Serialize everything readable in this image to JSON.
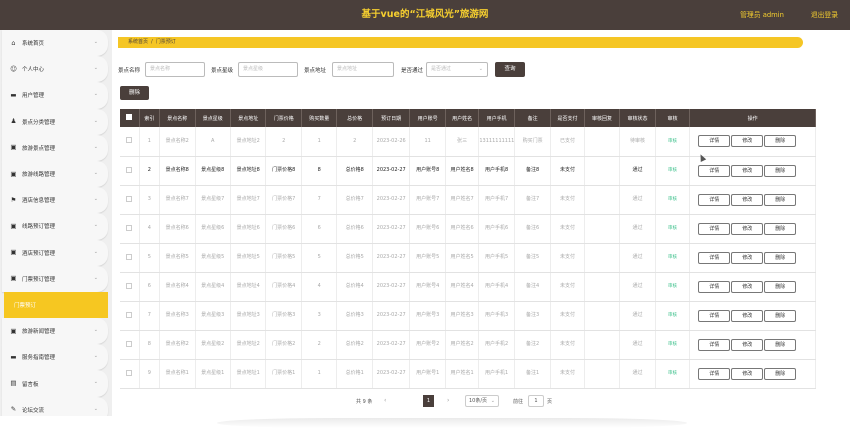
{
  "header": {
    "title": "基于vue的“江城风光”旅游网",
    "user": "管理员 admin",
    "logout": "退出登录"
  },
  "sidebar": {
    "items": [
      {
        "icon": "⌂",
        "label": "系统首页",
        "sub": false,
        "active": false
      },
      {
        "icon": "☺",
        "label": "个人中心",
        "sub": false,
        "active": false
      },
      {
        "icon": "▬",
        "label": "用户管理",
        "sub": false,
        "active": false
      },
      {
        "icon": "♟",
        "label": "景点分类管理",
        "sub": false,
        "active": false
      },
      {
        "icon": "▣",
        "label": "旅游景点管理",
        "sub": false,
        "active": false
      },
      {
        "icon": "▣",
        "label": "旅游线路管理",
        "sub": false,
        "active": false
      },
      {
        "icon": "⚑",
        "label": "酒店信息管理",
        "sub": false,
        "active": false
      },
      {
        "icon": "▣",
        "label": "线路预订管理",
        "sub": false,
        "active": false
      },
      {
        "icon": "▣",
        "label": "酒店预订管理",
        "sub": false,
        "active": false
      },
      {
        "icon": "▣",
        "label": "门票预订管理",
        "sub": false,
        "active": false
      },
      {
        "icon": "",
        "label": "门票预订",
        "sub": true,
        "active": true
      },
      {
        "icon": "▣",
        "label": "旅游新闻管理",
        "sub": false,
        "active": false
      },
      {
        "icon": "▬",
        "label": "服务指南管理",
        "sub": false,
        "active": false
      },
      {
        "icon": "▤",
        "label": "留言板",
        "sub": false,
        "active": false
      },
      {
        "icon": "✎",
        "label": "论坛交流",
        "sub": false,
        "active": false
      }
    ]
  },
  "breadcrumb": {
    "home": "系统首页",
    "sep": "/",
    "current": "门票预订"
  },
  "search": {
    "name_label": "景点名称",
    "name_placeholder": "景点名称",
    "star_label": "景点星级",
    "star_placeholder": "景点星级",
    "addr_label": "景点地址",
    "addr_placeholder": "景点地址",
    "paid_label": "是否通过",
    "paid_placeholder": "是否通过",
    "query_label": "查询"
  },
  "delete_all_label": "删除",
  "table": {
    "headers": [
      "",
      "索引",
      "景点名称",
      "景点星级",
      "景点地址",
      "门票价格",
      "购买数量",
      "总价格",
      "预订日期",
      "用户账号",
      "用户姓名",
      "用户手机",
      "备注",
      "是否支付",
      "审核回复",
      "审核状态",
      "审核",
      "操作"
    ],
    "rows": [
      {
        "idx": "1",
        "name": "景点名称2",
        "star": "A",
        "addr": "景点地址2",
        "price": "2",
        "qty": "1",
        "total": "2",
        "date": "2023-02-26",
        "acct": "11",
        "uname": "张三",
        "phone": "13111111111",
        "note": "购买门票",
        "pay": "已支付",
        "reply": "",
        "status": "待审核",
        "audit": "审核",
        "hl": false
      },
      {
        "idx": "2",
        "name": "景点名称8",
        "star": "景点星级8",
        "addr": "景点地址8",
        "price": "门票价格8",
        "qty": "8",
        "total": "总价格8",
        "date": "2023-02-27",
        "acct": "用户账号8",
        "uname": "用户姓名8",
        "phone": "用户手机8",
        "note": "备注8",
        "pay": "未支付",
        "reply": "",
        "status": "通过",
        "audit": "审核",
        "hl": true
      },
      {
        "idx": "3",
        "name": "景点名称7",
        "star": "景点星级7",
        "addr": "景点地址7",
        "price": "门票价格7",
        "qty": "7",
        "total": "总价格7",
        "date": "2023-02-27",
        "acct": "用户账号7",
        "uname": "用户姓名7",
        "phone": "用户手机7",
        "note": "备注7",
        "pay": "未支付",
        "reply": "",
        "status": "通过",
        "audit": "审核",
        "hl": false
      },
      {
        "idx": "4",
        "name": "景点名称6",
        "star": "景点星级6",
        "addr": "景点地址6",
        "price": "门票价格6",
        "qty": "6",
        "total": "总价格6",
        "date": "2023-02-27",
        "acct": "用户账号6",
        "uname": "用户姓名6",
        "phone": "用户手机6",
        "note": "备注6",
        "pay": "未支付",
        "reply": "",
        "status": "通过",
        "audit": "审核",
        "hl": false
      },
      {
        "idx": "5",
        "name": "景点名称5",
        "star": "景点星级5",
        "addr": "景点地址5",
        "price": "门票价格5",
        "qty": "5",
        "total": "总价格5",
        "date": "2023-02-27",
        "acct": "用户账号5",
        "uname": "用户姓名5",
        "phone": "用户手机5",
        "note": "备注5",
        "pay": "未支付",
        "reply": "",
        "status": "通过",
        "audit": "审核",
        "hl": false
      },
      {
        "idx": "6",
        "name": "景点名称4",
        "star": "景点星级4",
        "addr": "景点地址4",
        "price": "门票价格4",
        "qty": "4",
        "total": "总价格4",
        "date": "2023-02-27",
        "acct": "用户账号4",
        "uname": "用户姓名4",
        "phone": "用户手机4",
        "note": "备注4",
        "pay": "未支付",
        "reply": "",
        "status": "通过",
        "audit": "审核",
        "hl": false
      },
      {
        "idx": "7",
        "name": "景点名称3",
        "star": "景点星级3",
        "addr": "景点地址3",
        "price": "门票价格3",
        "qty": "3",
        "total": "总价格3",
        "date": "2023-02-27",
        "acct": "用户账号3",
        "uname": "用户姓名3",
        "phone": "用户手机3",
        "note": "备注3",
        "pay": "未支付",
        "reply": "",
        "status": "通过",
        "audit": "审核",
        "hl": false
      },
      {
        "idx": "8",
        "name": "景点名称2",
        "star": "景点星级2",
        "addr": "景点地址2",
        "price": "门票价格2",
        "qty": "2",
        "total": "总价格2",
        "date": "2023-02-27",
        "acct": "用户账号2",
        "uname": "用户姓名2",
        "phone": "用户手机2",
        "note": "备注2",
        "pay": "未支付",
        "reply": "",
        "status": "通过",
        "audit": "审核",
        "hl": false
      },
      {
        "idx": "9",
        "name": "景点名称1",
        "star": "景点星级1",
        "addr": "景点地址1",
        "price": "门票价格1",
        "qty": "1",
        "total": "总价格1",
        "date": "2023-02-27",
        "acct": "用户账号1",
        "uname": "用户姓名1",
        "phone": "用户手机1",
        "note": "备注1",
        "pay": "未支付",
        "reply": "",
        "status": "通过",
        "audit": "审核",
        "hl": false
      }
    ],
    "detail_label": "详情",
    "edit_label": "修改",
    "delete_label": "删除"
  },
  "pager": {
    "total": "共 9 条",
    "prev": "‹",
    "page": "1",
    "next": "›",
    "page_size": "10条/页",
    "goto_prefix": "前往",
    "goto_value": "1",
    "goto_suffix": "页"
  },
  "colors": {
    "brand_dark": "#4a3f3b",
    "accent": "#f5c625",
    "audit_green": "#3cc08b"
  }
}
